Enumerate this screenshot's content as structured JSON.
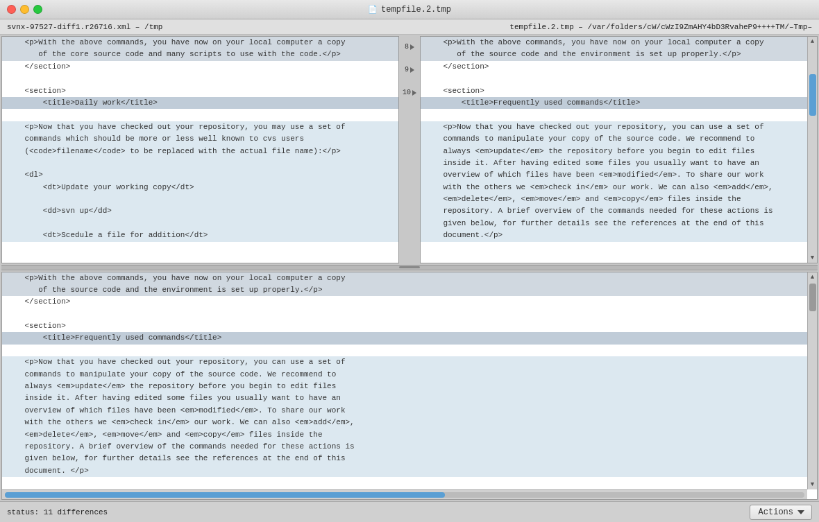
{
  "titlebar": {
    "title": "tempfile.2.tmp",
    "file_icon": "📄"
  },
  "pathbar": {
    "left": "svnx-97527-diff1.r26716.xml – /tmp",
    "right": "tempfile.2.tmp – /var/folders/cW/cWzI9ZmAHY4bD3RvaheP9++++TM/–Tmp–"
  },
  "diff": {
    "line_numbers": [
      "8",
      "9",
      "10"
    ],
    "left_lines": [
      {
        "text": "    <p>With the above commands, you have now on your local computer a copy",
        "style": "changed"
      },
      {
        "text": "       of the core source code and many scripts to use with the code.</p>",
        "style": "changed"
      },
      {
        "text": "    </section>",
        "style": "normal"
      },
      {
        "text": "",
        "style": "normal"
      },
      {
        "text": "    <section>",
        "style": "normal"
      },
      {
        "text": "        <title>Daily work</title>",
        "style": "section-header"
      },
      {
        "text": "",
        "style": "normal"
      },
      {
        "text": "    <p>Now that you have checked out your repository, you may use a set of",
        "style": "blue-light"
      },
      {
        "text": "    commands which should be more or less well known to cvs users",
        "style": "blue-light"
      },
      {
        "text": "    (<code>filename</code> to be replaced with the actual file name):</p>",
        "style": "blue-light"
      },
      {
        "text": "",
        "style": "blue-light"
      },
      {
        "text": "    <dl>",
        "style": "blue-light"
      },
      {
        "text": "        <dt>Update your working copy</dt>",
        "style": "blue-light"
      },
      {
        "text": "",
        "style": "blue-light"
      },
      {
        "text": "        <dd>svn up</dd>",
        "style": "blue-light"
      },
      {
        "text": "",
        "style": "blue-light"
      },
      {
        "text": "        <dt>Scedule a file for addition</dt>",
        "style": "blue-light"
      }
    ],
    "right_lines": [
      {
        "text": "    <p>With the above commands, you have now on your local computer a copy",
        "style": "changed"
      },
      {
        "text": "       of the source code and the environment is set up properly.</p>",
        "style": "changed"
      },
      {
        "text": "    </section>",
        "style": "normal"
      },
      {
        "text": "",
        "style": "normal"
      },
      {
        "text": "    <section>",
        "style": "normal"
      },
      {
        "text": "        <title>Frequently used commands</title>",
        "style": "section-header"
      },
      {
        "text": "",
        "style": "normal"
      },
      {
        "text": "    <p>Now that you have checked out your repository, you can use a set of",
        "style": "blue-light"
      },
      {
        "text": "    commands to manipulate your copy of the source code. We recommend to",
        "style": "blue-light"
      },
      {
        "text": "    always <em>update</em> the repository before you begin to edit files",
        "style": "blue-light"
      },
      {
        "text": "    inside it. After having edited some files you usually want to have an",
        "style": "blue-light"
      },
      {
        "text": "    overview of which files have been <em>modified</em>. To share our work",
        "style": "blue-light"
      },
      {
        "text": "    with the others we <em>check in</em> our work. We can also <em>add</em>,",
        "style": "blue-light"
      },
      {
        "text": "    <em>delete</em>, <em>move</em> and <em>copy</em> files inside the",
        "style": "blue-light"
      },
      {
        "text": "    repository. A brief overview of the commands needed for these actions is",
        "style": "blue-light"
      },
      {
        "text": "    given below, for further details see the references at the end of this",
        "style": "blue-light"
      },
      {
        "text": "    document.</p>",
        "style": "blue-light"
      }
    ]
  },
  "bottom": {
    "lines": [
      {
        "text": "    <p>With the above commands, you have now on your local computer a copy",
        "style": "changed"
      },
      {
        "text": "       of the source code and the environment is set up properly.</p>",
        "style": "changed"
      },
      {
        "text": "    </section>",
        "style": "normal"
      },
      {
        "text": "",
        "style": "normal"
      },
      {
        "text": "    <section>",
        "style": "normal"
      },
      {
        "text": "        <title>Frequently used commands</title>",
        "style": "section-header"
      },
      {
        "text": "",
        "style": "normal"
      },
      {
        "text": "    <p>Now that you have checked out your repository, you can use a set of",
        "style": "blue-light"
      },
      {
        "text": "    commands to manipulate your copy of the source code. We recommend to",
        "style": "blue-light"
      },
      {
        "text": "    always <em>update</em> the repository before you begin to edit files",
        "style": "blue-light"
      },
      {
        "text": "    inside it. After having edited some files you usually want to have an",
        "style": "blue-light"
      },
      {
        "text": "    overview of which files have been <em>modified</em>. To share our work",
        "style": "blue-light"
      },
      {
        "text": "    with the others we <em>check in</em> our work. We can also <em>add</em>,",
        "style": "blue-light"
      },
      {
        "text": "    <em>delete</em>, <em>move</em> and <em>copy</em> files inside the",
        "style": "blue-light"
      },
      {
        "text": "    repository. A brief overview of the commands needed for these actions is",
        "style": "blue-light"
      },
      {
        "text": "    given below, for further details see the references at the end of this",
        "style": "blue-light"
      },
      {
        "text": "    document. </p>",
        "style": "blue-light"
      }
    ]
  },
  "statusbar": {
    "status": "status:  11 differences",
    "actions_label": "Actions"
  }
}
